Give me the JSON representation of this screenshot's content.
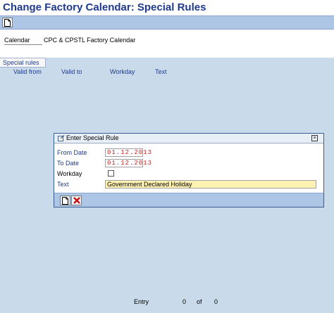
{
  "window": {
    "title": "Change Factory Calendar: Special Rules"
  },
  "toolbar": {
    "new_icon": "document-icon"
  },
  "calendar": {
    "label": "Calendar",
    "value": "CPC & CPSTL Factory Calendar"
  },
  "special_rules": {
    "tab_label": "Special rules",
    "columns": [
      "Valid from",
      "Valid to",
      "Workday",
      "Text"
    ]
  },
  "dialog": {
    "title": "Enter Special Rule",
    "fields": {
      "from_date": {
        "label": "From Date",
        "value": "01.12.2013"
      },
      "to_date": {
        "label": "To Date",
        "value": "01.12.2013"
      },
      "workday": {
        "label": "Workday",
        "checked": false
      },
      "text": {
        "label": "Text",
        "value": "Government Declared Holiday"
      }
    }
  },
  "status": {
    "entry_label": "Entry",
    "current": "0",
    "of_label": "of",
    "total": "0"
  },
  "colors": {
    "title": "#1f3a8c",
    "toolbar": "#aec6e6",
    "panel": "#c9dbea",
    "date_text": "#cc2020",
    "text_field_bg": "#fff2b3"
  }
}
